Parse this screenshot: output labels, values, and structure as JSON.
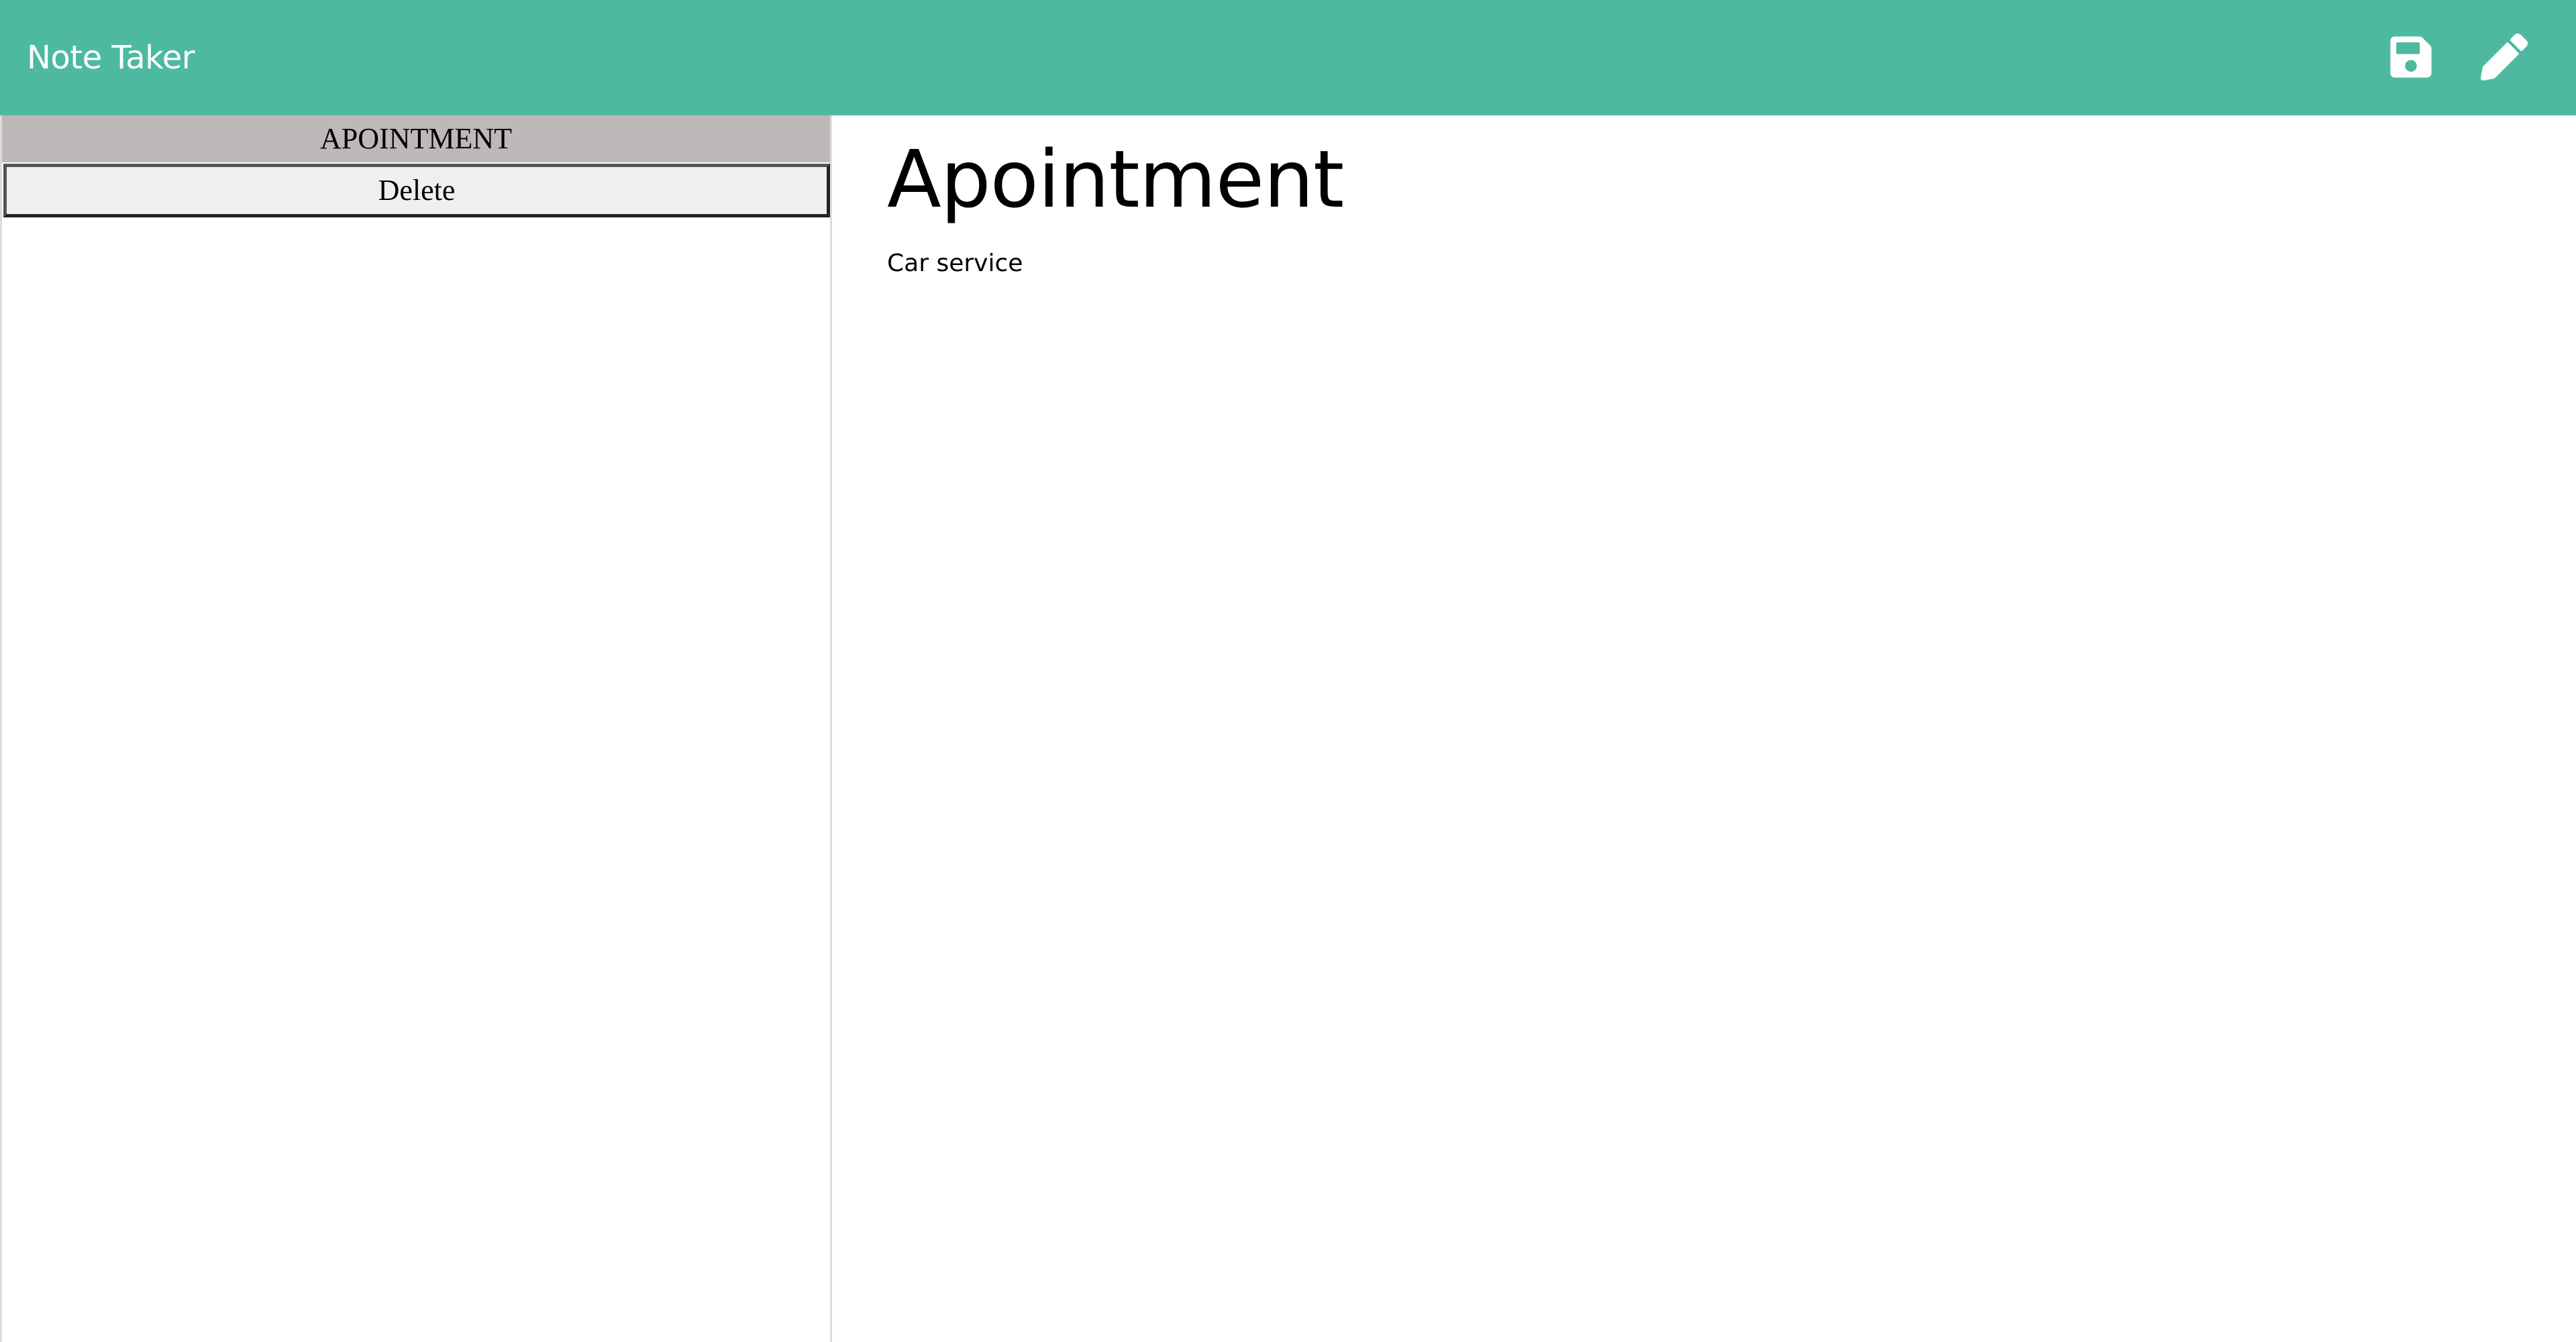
{
  "app": {
    "title": "Note Taker",
    "accent_color": "#4cb9a0"
  },
  "toolbar": {
    "save_icon": "floppy-disk-icon",
    "edit_icon": "pencil-icon"
  },
  "sidebar": {
    "notes": [
      {
        "label": "APOINTMENT",
        "delete_label": "Delete"
      }
    ]
  },
  "main": {
    "note_title": "Apointment",
    "note_text": "Car service"
  }
}
